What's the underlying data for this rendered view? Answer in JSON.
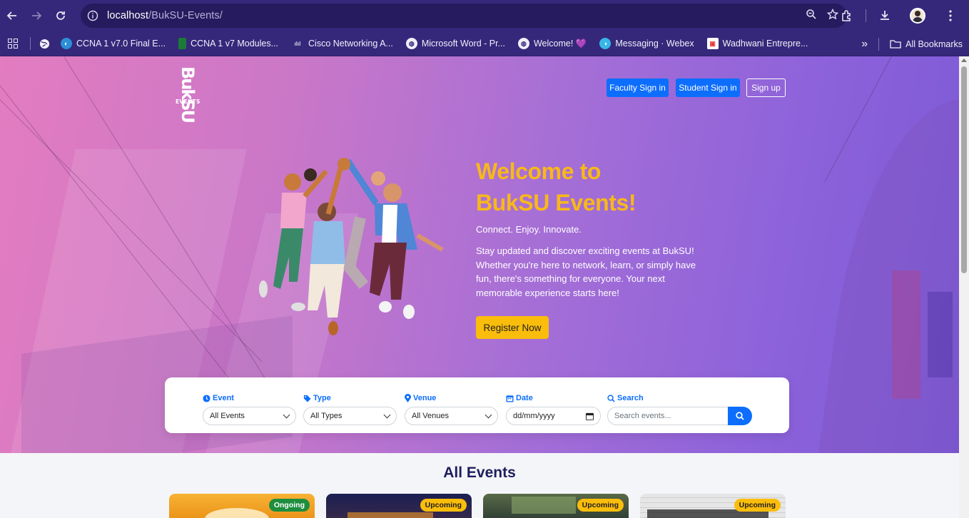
{
  "browser": {
    "url_host": "localhost",
    "url_path": "/BukSU-Events/",
    "bookmarks": [
      {
        "label": "CCNA 1 v7.0 Final E...",
        "icon": "ccna-icon",
        "color": "#2c8fd6"
      },
      {
        "label": "CCNA 1 v7 Modules...",
        "icon": "bookmark-green-icon",
        "color": "#1d7a36"
      },
      {
        "label": "Cisco Networking A...",
        "icon": "cisco-icon",
        "color": "#cfd8e6"
      },
      {
        "label": "Microsoft Word - Pr...",
        "icon": "globe-icon",
        "color": "#ffffff"
      },
      {
        "label": "Welcome! 💜",
        "icon": "globe-icon",
        "color": "#ffffff"
      },
      {
        "label": "Messaging · Webex",
        "icon": "webex-icon",
        "color": "#38b6e8"
      },
      {
        "label": "Wadhwani Entrepre...",
        "icon": "wadhwani-icon",
        "color": "#e53935"
      }
    ],
    "all_bookmarks_label": "All Bookmarks"
  },
  "header": {
    "logo_text": "BukSU",
    "logo_sub": "EVENTS",
    "faculty_signin": "Faculty Sign in",
    "student_signin": "Student Sign in",
    "signup": "Sign up"
  },
  "hero": {
    "title_line1": "Welcome to",
    "title_line2": "BukSU Events!",
    "tagline": "Connect. Enjoy. Innovate.",
    "description": "Stay updated and discover exciting events at BukSU! Whether you're here to network, learn, or simply have fun, there's something for everyone. Your next memorable experience starts here!",
    "register_label": "Register Now"
  },
  "filters": {
    "event": {
      "label": "Event",
      "value": "All Events"
    },
    "type": {
      "label": "Type",
      "value": "All Types"
    },
    "venue": {
      "label": "Venue",
      "value": "All Venues"
    },
    "date": {
      "label": "Date",
      "value": "dd/mm/yyyy"
    },
    "search": {
      "label": "Search",
      "placeholder": "Search events..."
    }
  },
  "events": {
    "title": "All Events",
    "cards": [
      {
        "status": "Ongoing",
        "bg": "#f0a321"
      },
      {
        "status": "Upcoming",
        "bg": "#1b1f52"
      },
      {
        "status": "Upcoming",
        "bg": "#3a4a3c"
      },
      {
        "status": "Upcoming",
        "bg": "#dedede"
      }
    ]
  },
  "colors": {
    "accent": "#0d6efd",
    "highlight": "#f8b81a",
    "chrome": "#35287a"
  }
}
